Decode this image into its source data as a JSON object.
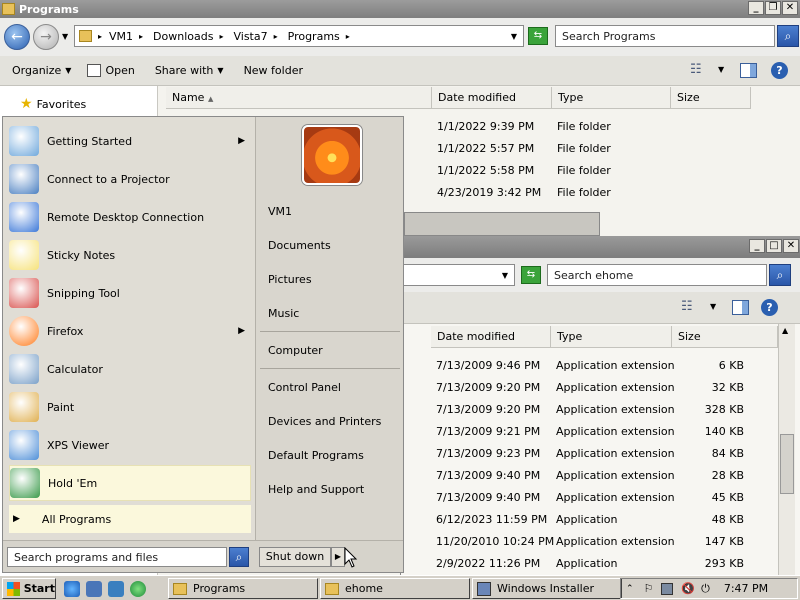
{
  "window1": {
    "title": "Programs",
    "breadcrumbs": [
      "VM1",
      "Downloads",
      "Vista7",
      "Programs"
    ],
    "search_placeholder": "Search Programs",
    "toolbar": {
      "organize": "Organize",
      "open": "Open",
      "share_with": "Share with",
      "new_folder": "New folder"
    },
    "sidebar": {
      "favorites": "Favorites"
    },
    "columns": {
      "name": "Name",
      "date": "Date modified",
      "type": "Type",
      "size": "Size"
    },
    "rows": [
      {
        "date": "1/1/2022 9:39 PM",
        "type": "File folder"
      },
      {
        "date": "1/1/2022 5:57 PM",
        "type": "File folder"
      },
      {
        "date": "1/1/2022 5:58 PM",
        "type": "File folder"
      },
      {
        "date": "4/23/2019 3:42 PM",
        "type": "File folder"
      }
    ]
  },
  "window2": {
    "search_placeholder": "Search ehome",
    "columns": {
      "date": "Date modified",
      "type": "Type",
      "size": "Size"
    },
    "rows": [
      {
        "date": "7/13/2009 9:46 PM",
        "type": "Application extension",
        "size": "6 KB"
      },
      {
        "date": "7/13/2009 9:20 PM",
        "type": "Application extension",
        "size": "32 KB"
      },
      {
        "date": "7/13/2009 9:20 PM",
        "type": "Application extension",
        "size": "328 KB"
      },
      {
        "date": "7/13/2009 9:21 PM",
        "type": "Application extension",
        "size": "140 KB"
      },
      {
        "date": "7/13/2009 9:23 PM",
        "type": "Application extension",
        "size": "84 KB"
      },
      {
        "date": "7/13/2009 9:40 PM",
        "type": "Application extension",
        "size": "28 KB"
      },
      {
        "date": "7/13/2009 9:40 PM",
        "type": "Application extension",
        "size": "45 KB"
      },
      {
        "date": "6/12/2023 11:59 PM",
        "type": "Application",
        "size": "48 KB"
      },
      {
        "date": "11/20/2010 10:24 PM",
        "type": "Application extension",
        "size": "147 KB"
      },
      {
        "date": "2/9/2022 11:26 PM",
        "type": "Application",
        "size": "293 KB"
      }
    ]
  },
  "start_menu": {
    "programs": [
      {
        "label": "Getting Started",
        "icon": "getting-started-icon",
        "submenu": true
      },
      {
        "label": "Connect to a Projector",
        "icon": "projector-icon",
        "submenu": false
      },
      {
        "label": "Remote Desktop Connection",
        "icon": "remote-desktop-icon",
        "submenu": false
      },
      {
        "label": "Sticky Notes",
        "icon": "sticky-notes-icon",
        "submenu": false
      },
      {
        "label": "Snipping Tool",
        "icon": "snipping-tool-icon",
        "submenu": false
      },
      {
        "label": "Firefox",
        "icon": "firefox-icon",
        "submenu": true
      },
      {
        "label": "Calculator",
        "icon": "calculator-icon",
        "submenu": false
      },
      {
        "label": "Paint",
        "icon": "paint-icon",
        "submenu": false
      },
      {
        "label": "XPS Viewer",
        "icon": "xps-viewer-icon",
        "submenu": false
      },
      {
        "label": "Hold 'Em",
        "icon": "hold-em-icon",
        "submenu": false
      }
    ],
    "all_programs": "All Programs",
    "search_placeholder": "Search programs and files",
    "right_items": [
      "VM1",
      "Documents",
      "Pictures",
      "Music",
      "Computer",
      "Control Panel",
      "Devices and Printers",
      "Default Programs",
      "Help and Support"
    ],
    "shutdown": "Shut down"
  },
  "taskbar": {
    "start": "Start",
    "buttons": [
      "Programs",
      "ehome",
      "Windows Installer"
    ],
    "clock": "7:47 PM"
  },
  "colors": {
    "accent": "#2a5fb0",
    "highlight": "#fbf8dc"
  }
}
